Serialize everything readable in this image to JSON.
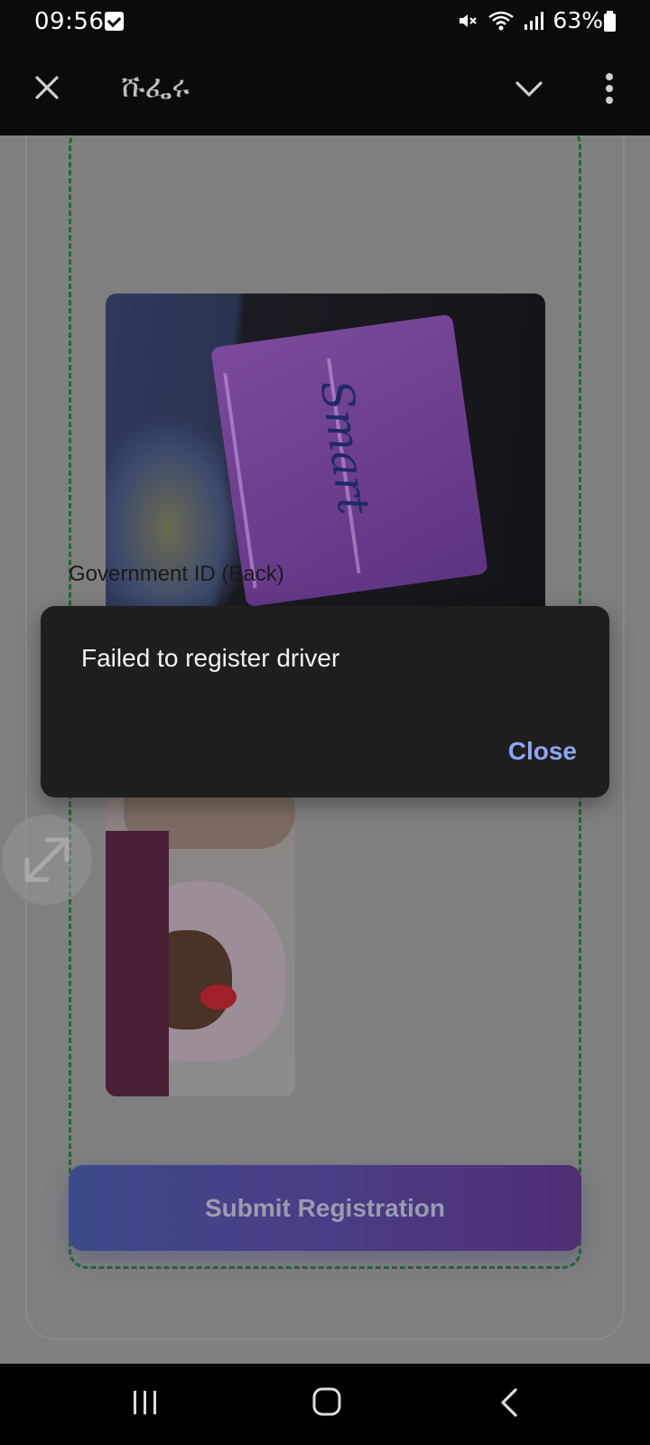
{
  "status_bar": {
    "time": "09:56",
    "battery_text": "63%",
    "icons": [
      "notification-check-icon",
      "mute-icon",
      "wifi-icon",
      "signal-icon",
      "battery-icon"
    ]
  },
  "app_bar": {
    "title": "ሹፌሩ",
    "icons": [
      "close-icon",
      "chevron-down-icon",
      "more-vert-icon"
    ]
  },
  "form": {
    "back_id_label": "Government ID (Back)",
    "submit_label": "Submit Registration",
    "photo_front_text": "Smart"
  },
  "dialog": {
    "message": "Failed to register driver",
    "close_label": "Close"
  },
  "colors": {
    "dashed_border": "#1f6a2e",
    "close_accent": "#8ea6ef",
    "button_gradient_start": "#3d4a8a",
    "button_gradient_end": "#4f2f74"
  },
  "nav_bar": {
    "icons": [
      "recents-icon",
      "home-icon",
      "back-icon"
    ]
  }
}
